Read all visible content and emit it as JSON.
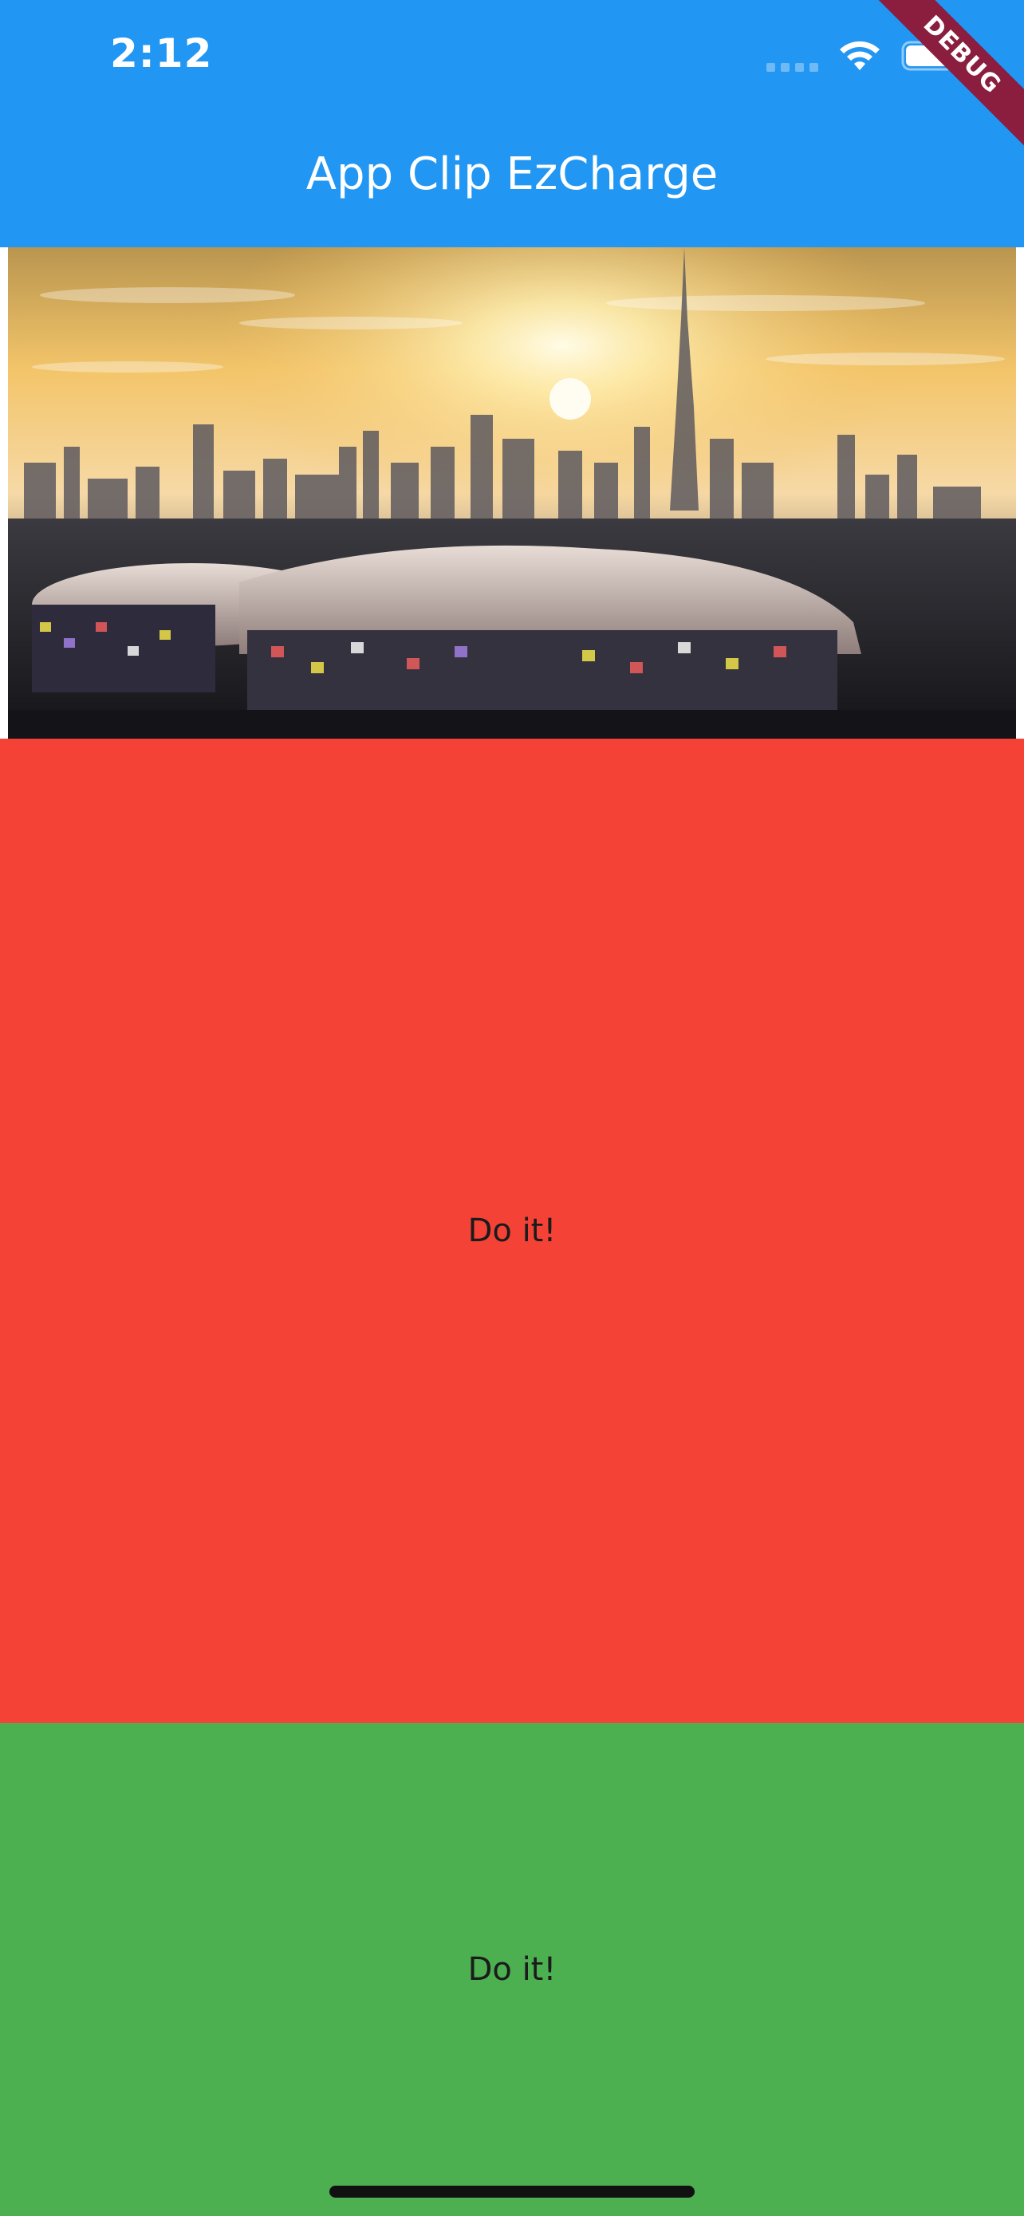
{
  "status_bar": {
    "time": "2:12",
    "icons": [
      "cellular-signal-icon",
      "wifi-icon",
      "battery-icon"
    ]
  },
  "app_bar": {
    "title": "App Clip EzCharge",
    "background_color": "#2196f3"
  },
  "debug_banner": {
    "label": "DEBUG",
    "color": "#8b1d3f"
  },
  "hero_image": {
    "subject": "city-skyline-sunset-with-stadium"
  },
  "panels": [
    {
      "label": "Do it!",
      "color": "#f44336"
    },
    {
      "label": "Do it!",
      "color": "#4caf50"
    }
  ]
}
